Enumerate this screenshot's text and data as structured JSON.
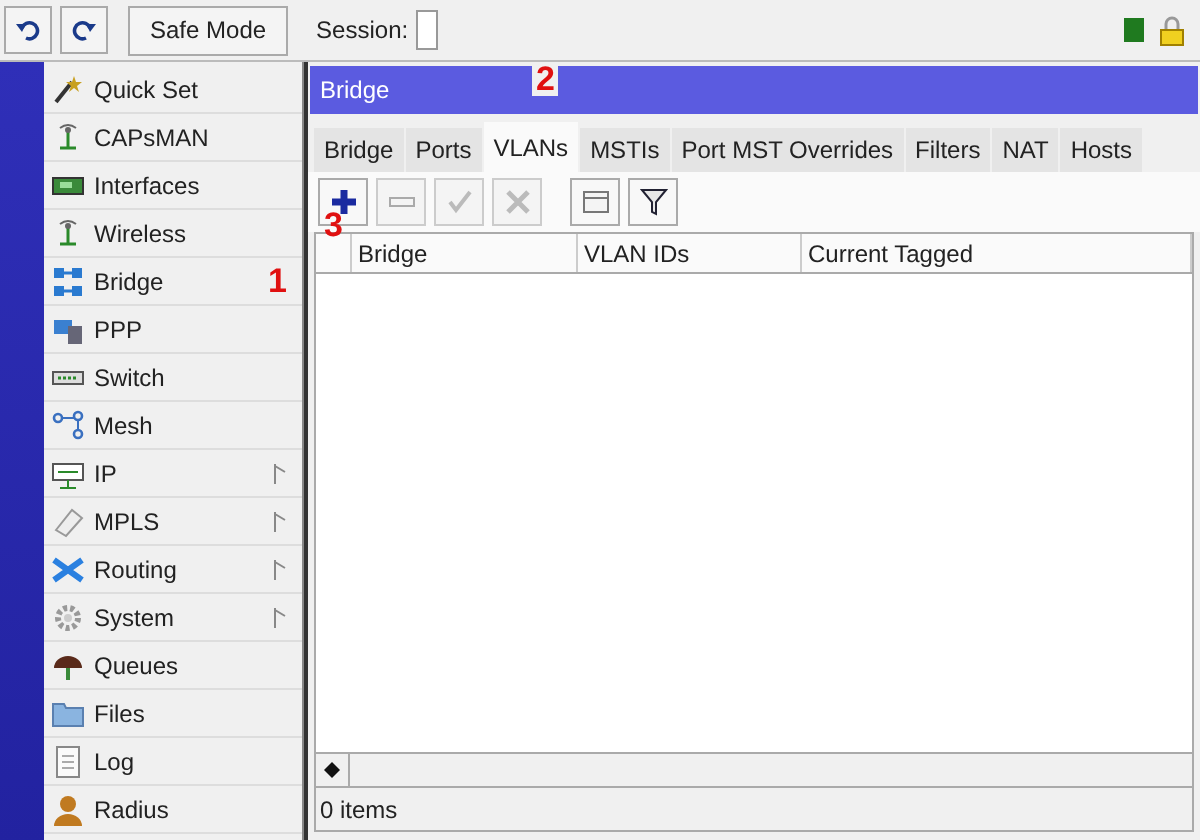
{
  "toolbar": {
    "safe_mode": "Safe Mode",
    "session_label": "Session:"
  },
  "sidebar": {
    "items": [
      {
        "label": "Quick Set",
        "kind": "wand",
        "submenu": false
      },
      {
        "label": "CAPsMAN",
        "kind": "antenna",
        "submenu": false
      },
      {
        "label": "Interfaces",
        "kind": "card",
        "submenu": false
      },
      {
        "label": "Wireless",
        "kind": "antenna",
        "submenu": false
      },
      {
        "label": "Bridge",
        "kind": "bridge",
        "submenu": false
      },
      {
        "label": "PPP",
        "kind": "ppp",
        "submenu": false
      },
      {
        "label": "Switch",
        "kind": "switch",
        "submenu": false
      },
      {
        "label": "Mesh",
        "kind": "mesh",
        "submenu": false
      },
      {
        "label": "IP",
        "kind": "ip",
        "submenu": true
      },
      {
        "label": "MPLS",
        "kind": "tag",
        "submenu": true
      },
      {
        "label": "Routing",
        "kind": "routing",
        "submenu": true
      },
      {
        "label": "System",
        "kind": "gear",
        "submenu": true
      },
      {
        "label": "Queues",
        "kind": "queue",
        "submenu": false
      },
      {
        "label": "Files",
        "kind": "folder",
        "submenu": false
      },
      {
        "label": "Log",
        "kind": "doc",
        "submenu": false
      },
      {
        "label": "Radius",
        "kind": "user",
        "submenu": false
      }
    ]
  },
  "annotations": [
    "1",
    "2",
    "3"
  ],
  "window": {
    "title": "Bridge",
    "tabs": [
      {
        "label": "Bridge",
        "selected": false
      },
      {
        "label": "Ports",
        "selected": false
      },
      {
        "label": "VLANs",
        "selected": true
      },
      {
        "label": "MSTIs",
        "selected": false
      },
      {
        "label": "Port MST Overrides",
        "selected": false
      },
      {
        "label": "Filters",
        "selected": false
      },
      {
        "label": "NAT",
        "selected": false
      },
      {
        "label": "Hosts",
        "selected": false
      }
    ],
    "buttons": [
      {
        "kind": "add",
        "disabled": false
      },
      {
        "kind": "remove",
        "disabled": true
      },
      {
        "kind": "enable",
        "disabled": true
      },
      {
        "kind": "disable",
        "disabled": true
      },
      {
        "kind": "comment",
        "disabled": false
      },
      {
        "kind": "filter",
        "disabled": false
      }
    ],
    "table": {
      "columns": [
        "Bridge",
        "VLAN IDs",
        "Current Tagged"
      ]
    },
    "status": "0 items"
  }
}
